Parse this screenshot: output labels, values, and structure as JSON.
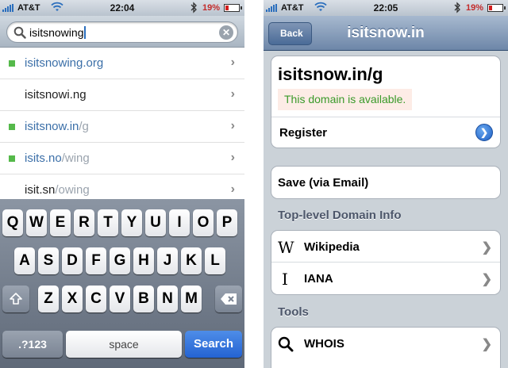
{
  "left_screen": {
    "status": {
      "carrier": "AT&T",
      "time": "22:04",
      "battery": "19%"
    },
    "search": {
      "query": "isitsnowing"
    },
    "results": [
      {
        "available": true,
        "highlight": "isitsnowing.org",
        "rest": ""
      },
      {
        "available": false,
        "highlight": "",
        "rest": "",
        "plain": "isitsnowi.ng"
      },
      {
        "available": true,
        "highlight": "isitsnow.in",
        "rest": "/g"
      },
      {
        "available": true,
        "highlight": "isits.no",
        "rest": "/wing"
      },
      {
        "available": false,
        "highlight": "",
        "rest": "",
        "plain": "isit.sn",
        "plain_rest": "/owing"
      }
    ],
    "keyboard": {
      "row1": [
        "Q",
        "W",
        "E",
        "R",
        "T",
        "Y",
        "U",
        "I",
        "O",
        "P"
      ],
      "row2": [
        "A",
        "S",
        "D",
        "F",
        "G",
        "H",
        "J",
        "K",
        "L"
      ],
      "row3": [
        "Z",
        "X",
        "C",
        "V",
        "B",
        "N",
        "M"
      ],
      "numbers_key": ".?123",
      "space_key": "space",
      "search_key": "Search",
      "shift_icon": "shift-icon",
      "delete_icon": "backspace-icon"
    }
  },
  "right_screen": {
    "status": {
      "carrier": "AT&T",
      "time": "22:05",
      "battery": "19%"
    },
    "nav": {
      "back_label": "Back",
      "title": "isitsnow.in"
    },
    "domain": {
      "name": "isitsnow.in/g",
      "availability": "This domain is available."
    },
    "register_label": "Register",
    "save_label": "Save (via Email)",
    "tld_header": "Top-level Domain Info",
    "tld_items": [
      {
        "icon": "W",
        "icon_name": "wikipedia-icon",
        "label": "Wikipedia"
      },
      {
        "icon": "I",
        "icon_name": "iana-icon",
        "label": "IANA"
      }
    ],
    "tools_header": "Tools",
    "tools_items": [
      {
        "icon_name": "search-icon",
        "label": "WHOIS"
      }
    ]
  },
  "colors": {
    "available_green": "#55b94a",
    "link_blue": "#3b6fa8",
    "nav_blue": "#6d86a8",
    "search_blue": "#2463d2"
  }
}
